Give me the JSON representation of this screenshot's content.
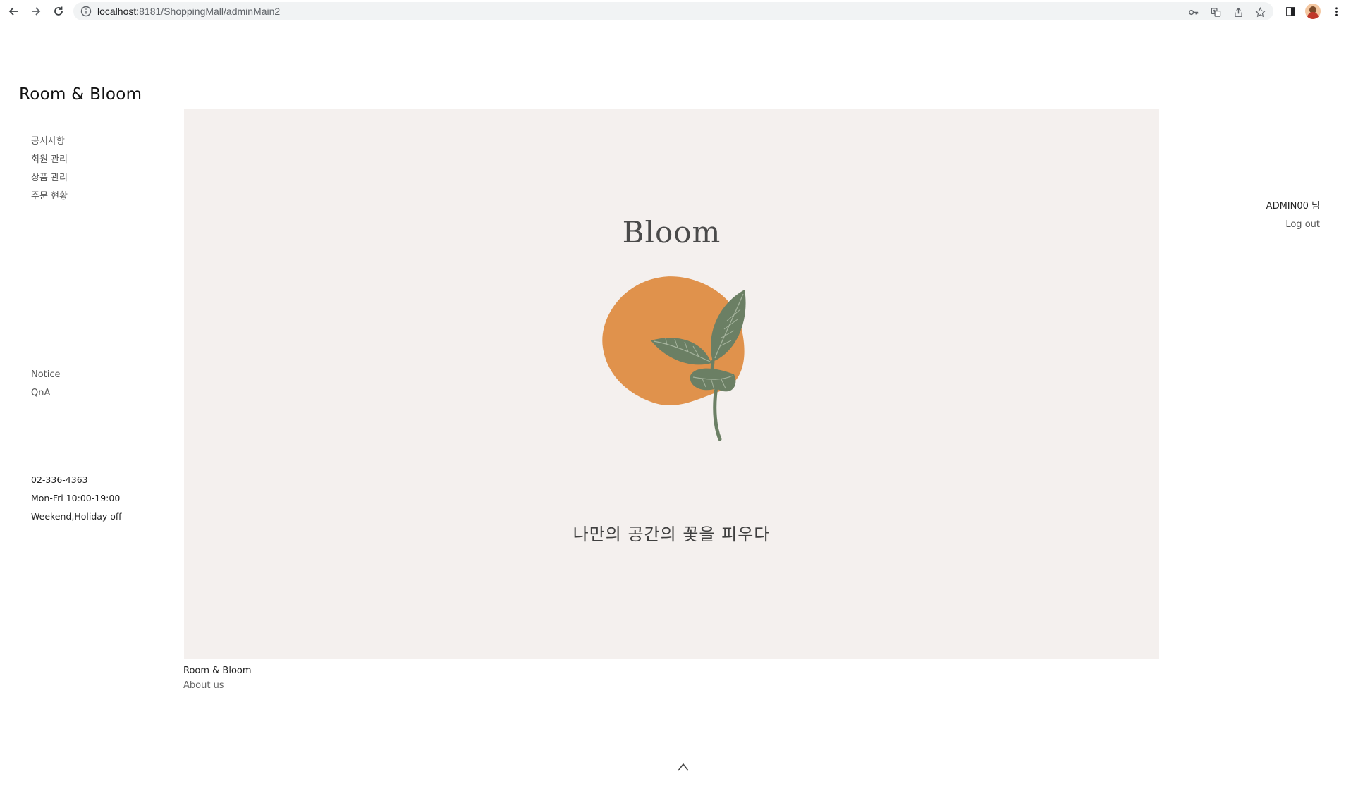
{
  "browser": {
    "url_host": "localhost",
    "url_path": ":8181/ShoppingMall/adminMain2"
  },
  "site": {
    "logo": "Room & Bloom"
  },
  "sidebar": {
    "menu": [
      {
        "label": "공지사항"
      },
      {
        "label": "회원 관리"
      },
      {
        "label": "상품 관리"
      },
      {
        "label": "주문 현황"
      }
    ],
    "sub_links": [
      {
        "label": "Notice"
      },
      {
        "label": "QnA"
      }
    ],
    "info": {
      "phone": "02-336-4363",
      "hours": "Mon-Fri 10:00-19:00",
      "closed": "Weekend,Holiday off"
    }
  },
  "hero": {
    "title": "Bloom",
    "tagline": "나만의 공간의 꽃을 피우다",
    "colors": {
      "background": "#f4f0ee",
      "blob": "#e0924c",
      "leaf": "#6b7f64"
    }
  },
  "user": {
    "name": "ADMIN00 님",
    "logout": "Log out"
  },
  "footer": {
    "brand": "Room & Bloom",
    "about": "About us"
  },
  "icons": {
    "back": "arrow-left-icon",
    "forward": "arrow-right-icon",
    "reload": "reload-icon",
    "scroll_top": "chevron-up-icon"
  }
}
